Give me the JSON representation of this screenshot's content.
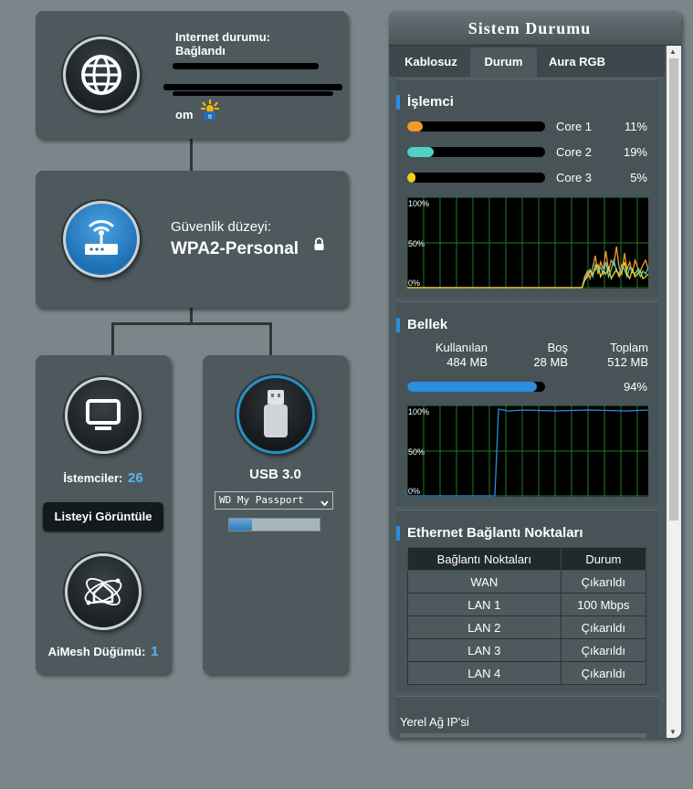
{
  "internet": {
    "status_label": "Internet durumu:",
    "status_value": "Bağlandı",
    "provider_suffix": "om"
  },
  "security": {
    "label": "Güvenlik düzeyi:",
    "value": "WPA2-Personal"
  },
  "clients": {
    "label": "İstemciler:",
    "count": "26",
    "view_button": "Listeyi Görüntüle"
  },
  "aimesh": {
    "label": "AiMesh Düğümü:",
    "count": "1"
  },
  "usb": {
    "title": "USB 3.0",
    "device_selected": "WD My Passport",
    "usage_fraction": 0.25
  },
  "panel": {
    "title": "Sistem Durumu",
    "tabs": [
      "Kablosuz",
      "Durum",
      "Aura RGB"
    ],
    "active_tab": "Durum"
  },
  "cpu": {
    "title": "İşlemci",
    "cores": [
      {
        "name": "Core 1",
        "value": "11%",
        "fraction": 0.11,
        "color": "#f29a2e"
      },
      {
        "name": "Core 2",
        "value": "19%",
        "fraction": 0.19,
        "color": "#4fd1c5"
      },
      {
        "name": "Core 3",
        "value": "5%",
        "fraction": 0.05,
        "color": "#f5d020"
      }
    ],
    "graph_labels": [
      "100%",
      "50%",
      "0%"
    ]
  },
  "memory": {
    "title": "Bellek",
    "used_label": "Kullanılan",
    "used_value": "484 MB",
    "free_label": "Boş",
    "free_value": "28 MB",
    "total_label": "Toplam",
    "total_value": "512 MB",
    "percent": "94%",
    "fraction": 0.94,
    "graph_labels": [
      "100%",
      "50%",
      "0%"
    ]
  },
  "ethernet": {
    "title": "Ethernet Bağlantı Noktaları",
    "headers": [
      "Bağlantı Noktaları",
      "Durum"
    ],
    "rows": [
      {
        "port": "WAN",
        "status": "Çıkarıldı"
      },
      {
        "port": "LAN 1",
        "status": "100 Mbps"
      },
      {
        "port": "LAN 2",
        "status": "Çıkarıldı"
      },
      {
        "port": "LAN 3",
        "status": "Çıkarıldı"
      },
      {
        "port": "LAN 4",
        "status": "Çıkarıldı"
      }
    ]
  },
  "lan_ip": {
    "title": "Yerel Ağ IP'si"
  },
  "icons": {
    "internet": "globe-icon",
    "router": "router-icon",
    "clients": "monitor-icon",
    "usb": "usb-drive-icon",
    "aimesh": "aimesh-icon",
    "lock": "lock-icon"
  },
  "colors": {
    "accent": "#2a8de0",
    "value_blue": "#5ab4f0",
    "card_bg": "#4d595d",
    "page_bg": "#7b868b"
  }
}
